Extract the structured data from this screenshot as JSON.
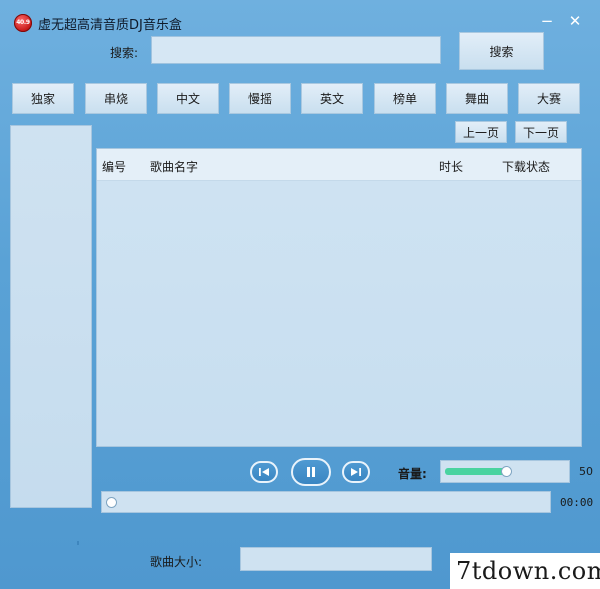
{
  "titlebar": {
    "logo_text": "40.9",
    "title": "虚无超高清音质DJ音乐盒",
    "minimize_glyph": "−",
    "close_glyph": "✕"
  },
  "search": {
    "label": "搜索:",
    "value": "",
    "placeholder": "",
    "button_label": "搜索"
  },
  "categories": [
    "独家",
    "串烧",
    "中文",
    "慢摇",
    "英文",
    "榜单",
    "舞曲",
    "大赛"
  ],
  "paging": {
    "prev": "上一页",
    "next": "下一页"
  },
  "table": {
    "columns": [
      "编号",
      "歌曲名字",
      "时长",
      "下载状态"
    ],
    "rows": []
  },
  "player": {
    "prev_icon": "skip-previous-icon",
    "play_icon": "pause-icon",
    "next_icon": "skip-next-icon",
    "volume_label": "音量:",
    "volume_value": "50",
    "volume_fraction": 0.5,
    "progress_fraction": 0,
    "time": "00:00"
  },
  "footer": {
    "size_label": "歌曲大小:",
    "size_value": "",
    "watermark": "7tdown.com"
  },
  "colors": {
    "background": "#5aa2d6",
    "panel": "#cfe2f1",
    "volume_fill": "#49d3a0",
    "logo_red": "#c21414"
  }
}
